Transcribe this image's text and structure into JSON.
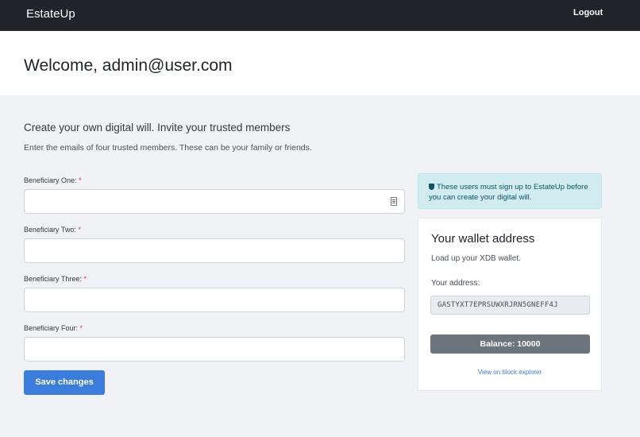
{
  "navbar": {
    "brand": "EstateUp",
    "logout_label": "Logout"
  },
  "page": {
    "welcome": "Welcome, admin@user.com"
  },
  "form": {
    "title": "Create your own digital will. Invite your trusted members",
    "subtitle": "Enter the emails of four trusted members. These can be your family or friends.",
    "required_marker": "*",
    "fields": [
      {
        "label": "Beneficiary One:",
        "value": ""
      },
      {
        "label": "Beneficiary Two:",
        "value": ""
      },
      {
        "label": "Beneficiary Three:",
        "value": ""
      },
      {
        "label": "Beneficiary Four:",
        "value": ""
      }
    ],
    "save_label": "Save changes"
  },
  "alert": {
    "icon": "shield-icon",
    "text": "These users must sign up to EstateUp before you can create your digital will."
  },
  "wallet": {
    "title": "Your wallet address",
    "subtitle": "Load up your XDB wallet.",
    "address_label": "Your address:",
    "address_value": "GASTYXT7EPRSUWXRJRN5GNEFF4J",
    "balance_label": "Balance: 10000",
    "explorer_link": "View on block explorer"
  },
  "colors": {
    "navbar": "#212529",
    "primary": "#3b7ddd",
    "alert_bg": "#d1ecf1",
    "balance_bg": "#6c757d",
    "required": "#dc3545"
  }
}
